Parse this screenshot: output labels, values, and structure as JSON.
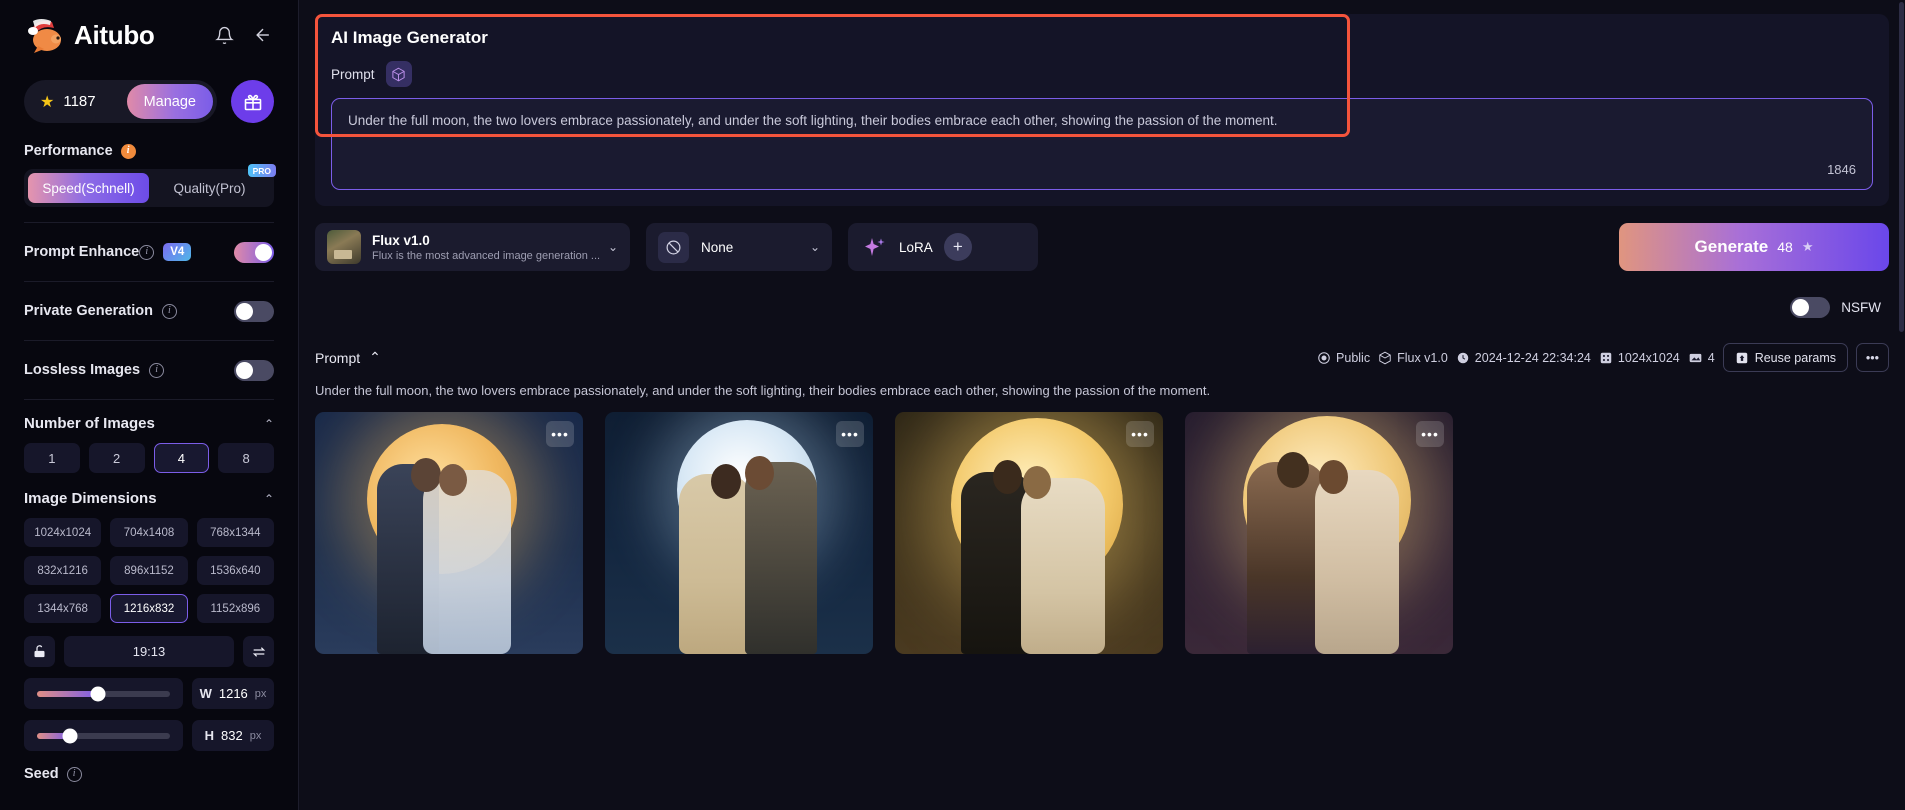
{
  "brand": {
    "name": "Aitubo",
    "bell_icon": "bell-icon",
    "back_icon": "arrow-left-icon"
  },
  "sidebar": {
    "credits": {
      "value": "1187",
      "star_icon": "star-icon",
      "manage_label": "Manage"
    },
    "gift_icon": "gift-icon",
    "performance": {
      "label": "Performance",
      "options": [
        {
          "label": "Speed(Schnell)",
          "selected": true,
          "badge": ""
        },
        {
          "label": "Quality(Pro)",
          "selected": false,
          "badge": "PRO"
        }
      ]
    },
    "prompt_enhance": {
      "label": "Prompt Enhance",
      "chip": "V4",
      "enabled": true
    },
    "private_generation": {
      "label": "Private Generation",
      "enabled": false
    },
    "lossless_images": {
      "label": "Lossless Images",
      "enabled": false
    },
    "number_of_images": {
      "label": "Number of Images",
      "options": [
        "1",
        "2",
        "4",
        "8"
      ],
      "selected": "4"
    },
    "image_dimensions": {
      "label": "Image Dimensions",
      "options": [
        "1024x1024",
        "704x1408",
        "768x1344",
        "832x1216",
        "896x1152",
        "1536x640",
        "1344x768",
        "1216x832",
        "1152x896"
      ],
      "selected": "1216x832"
    },
    "aspect_ratio": {
      "value": "19:13",
      "lock_icon": "unlock-icon",
      "swap_icon": "swap-icon"
    },
    "width": {
      "key": "W",
      "value": "1216",
      "unit": "px",
      "slider_percent": 46
    },
    "height": {
      "key": "H",
      "value": "832",
      "unit": "px",
      "slider_percent": 25
    },
    "seed": {
      "label": "Seed"
    }
  },
  "main": {
    "title": "AI Image Generator",
    "prompt_label": "Prompt",
    "dice_icon": "dice-icon",
    "prompt_value": "Under the full moon, the two lovers embrace passionately, and under the soft lighting, their bodies embrace each other, showing the passion of the moment.",
    "char_count": "1846",
    "model": {
      "name": "Flux v1.0",
      "description": "Flux is the most advanced image generation ...",
      "chevron_icon": "chevron-down-icon"
    },
    "style": {
      "value": "None",
      "icon": "no-style-icon",
      "chevron_icon": "chevron-down-icon"
    },
    "lora": {
      "label": "LoRA",
      "sparkle_icon": "sparkles-icon",
      "add_icon": "plus-icon"
    },
    "generate": {
      "label": "Generate",
      "cost": "48",
      "star_icon": "star-icon"
    },
    "nsfw": {
      "label": "NSFW",
      "enabled": false
    }
  },
  "results": {
    "prompt_label": "Prompt",
    "collapse_icon": "chevron-up-icon",
    "prompt_text": "Under the full moon, the two lovers embrace passionately, and under the soft lighting, their bodies embrace each other, showing the passion of the moment.",
    "meta": {
      "visibility": "Public",
      "visibility_icon": "eye-icon",
      "model": "Flux v1.0",
      "model_icon": "cube-icon",
      "timestamp": "2024-12-24 22:34:24",
      "clock_icon": "clock-icon",
      "resolution": "1024x1024",
      "resolution_icon": "grid-icon",
      "count": "4",
      "count_icon": "image-icon",
      "reuse_label": "Reuse params",
      "reuse_icon": "upload-icon",
      "more_icon": "ellipsis-icon"
    },
    "images": [
      {
        "menu_icon": "ellipsis-icon",
        "moon_color": "#f0b860",
        "sky_color": "#1b2b46"
      },
      {
        "menu_icon": "ellipsis-icon",
        "moon_color": "#cfe2f2",
        "sky_color": "#132338"
      },
      {
        "menu_icon": "ellipsis-icon",
        "moon_color": "#f3c96a",
        "sky_color": "#2a2418"
      },
      {
        "menu_icon": "ellipsis-icon",
        "moon_color": "#f0c97a",
        "sky_color": "#241b2e"
      }
    ]
  },
  "colors": {
    "accent": "#7b5de8",
    "highlight_outline": "#f4543c",
    "sidebar_bg": "#07070f",
    "main_bg": "#0d0d18"
  }
}
